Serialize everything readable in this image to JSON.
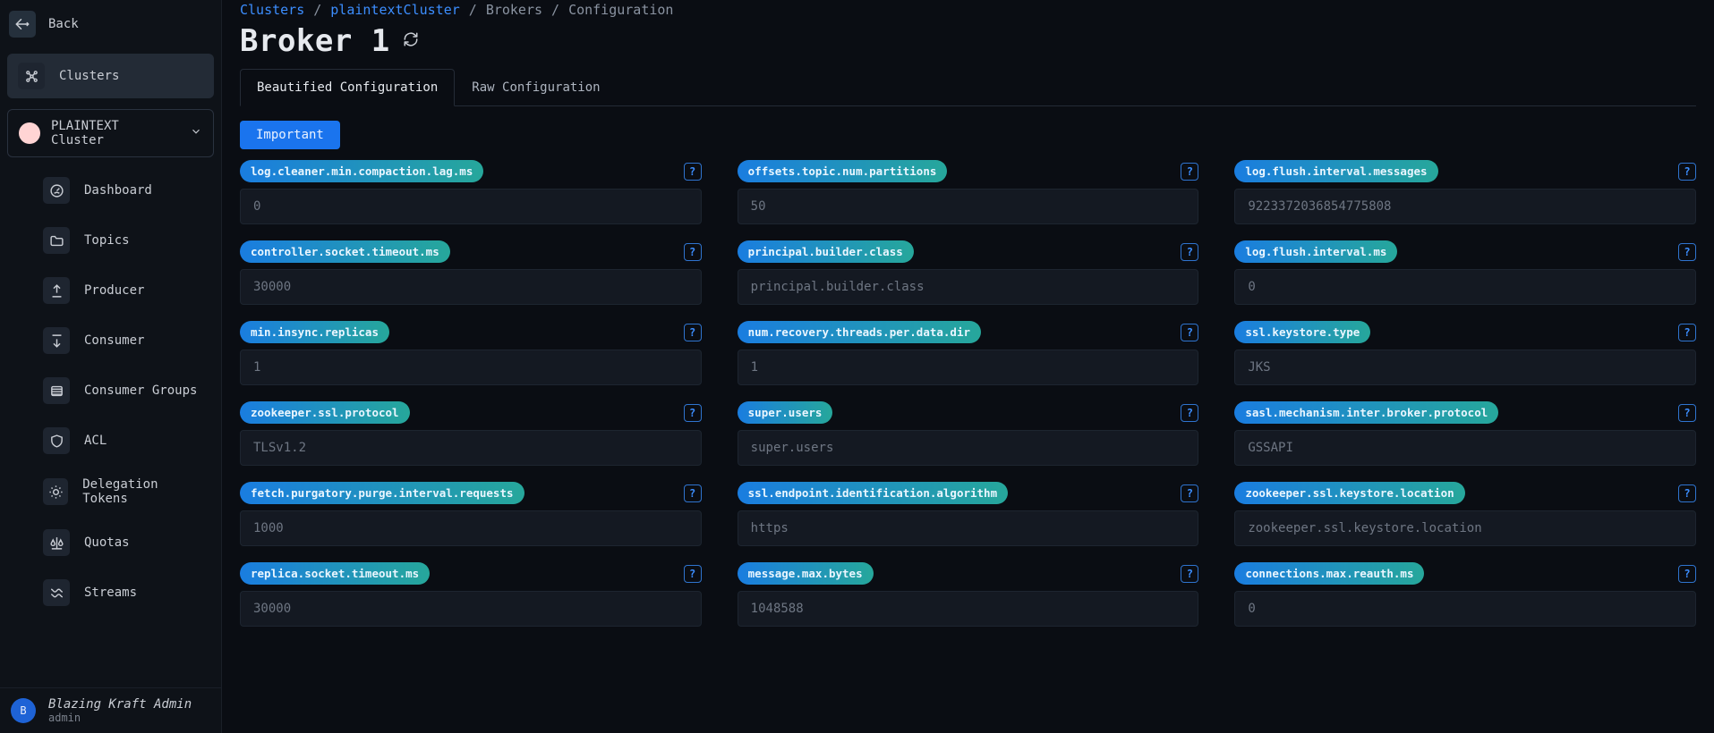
{
  "back_label": "Back",
  "sidebar": {
    "clusters_label": "Clusters",
    "cluster_name": "PLAINTEXT Cluster",
    "items": {
      "dashboard": "Dashboard",
      "topics": "Topics",
      "producer": "Producer",
      "consumer": "Consumer",
      "consumer_groups": "Consumer Groups",
      "acl": "ACL",
      "delegation_tokens": "Delegation Tokens",
      "quotas": "Quotas",
      "streams": "Streams"
    }
  },
  "footer": {
    "initial": "B",
    "name": "Blazing Kraft Admin",
    "sub": "admin"
  },
  "breadcrumb": {
    "clusters": "Clusters",
    "cluster": "plaintextCluster",
    "brokers": "Brokers",
    "config": "Configuration"
  },
  "page_title": "Broker 1",
  "tabs": {
    "beautified": "Beautified Configuration",
    "raw": "Raw Configuration"
  },
  "filter_label": "Important",
  "configs": [
    {
      "key": "log.cleaner.min.compaction.lag.ms",
      "value": "0"
    },
    {
      "key": "offsets.topic.num.partitions",
      "value": "50"
    },
    {
      "key": "log.flush.interval.messages",
      "value": "9223372036854775808"
    },
    {
      "key": "controller.socket.timeout.ms",
      "value": "30000"
    },
    {
      "key": "principal.builder.class",
      "value": "",
      "placeholder": "principal.builder.class"
    },
    {
      "key": "log.flush.interval.ms",
      "value": "0"
    },
    {
      "key": "min.insync.replicas",
      "value": "1"
    },
    {
      "key": "num.recovery.threads.per.data.dir",
      "value": "1"
    },
    {
      "key": "ssl.keystore.type",
      "value": "JKS"
    },
    {
      "key": "zookeeper.ssl.protocol",
      "value": "TLSv1.2"
    },
    {
      "key": "super.users",
      "value": "",
      "placeholder": "super.users"
    },
    {
      "key": "sasl.mechanism.inter.broker.protocol",
      "value": "GSSAPI"
    },
    {
      "key": "fetch.purgatory.purge.interval.requests",
      "value": "1000"
    },
    {
      "key": "ssl.endpoint.identification.algorithm",
      "value": "https"
    },
    {
      "key": "zookeeper.ssl.keystore.location",
      "value": "",
      "placeholder": "zookeeper.ssl.keystore.location"
    },
    {
      "key": "replica.socket.timeout.ms",
      "value": "30000"
    },
    {
      "key": "message.max.bytes",
      "value": "1048588"
    },
    {
      "key": "connections.max.reauth.ms",
      "value": "0"
    }
  ]
}
